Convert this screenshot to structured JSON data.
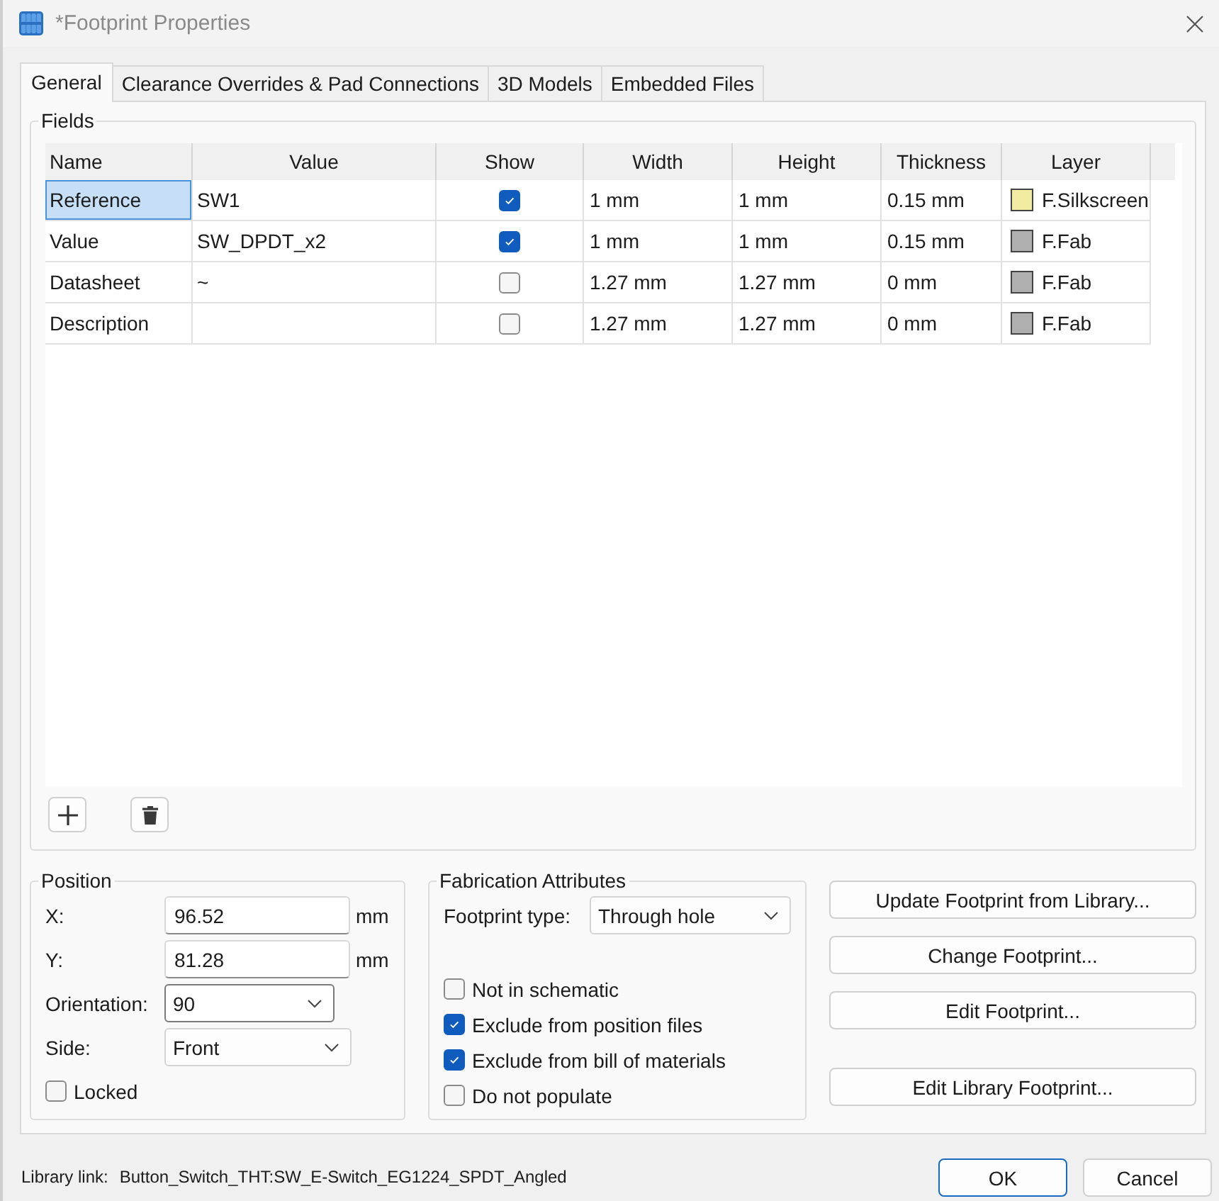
{
  "window": {
    "title": "*Footprint Properties"
  },
  "tabs": [
    {
      "label": "General",
      "selected": true
    },
    {
      "label": "Clearance Overrides & Pad Connections",
      "selected": false
    },
    {
      "label": "3D Models",
      "selected": false
    },
    {
      "label": "Embedded Files",
      "selected": false
    }
  ],
  "fields": {
    "title": "Fields",
    "columns": [
      "Name",
      "Value",
      "Show",
      "Width",
      "Height",
      "Thickness",
      "Layer"
    ],
    "rows": [
      {
        "name": "Reference",
        "value": "SW1",
        "show": true,
        "width": "1 mm",
        "height": "1 mm",
        "thickness": "0.15 mm",
        "layer": "F.Silkscreen",
        "color": "#f2eca2",
        "selected": true
      },
      {
        "name": "Value",
        "value": "SW_DPDT_x2",
        "show": true,
        "width": "1 mm",
        "height": "1 mm",
        "thickness": "0.15 mm",
        "layer": "F.Fab",
        "color": "#afafaf",
        "selected": false
      },
      {
        "name": "Datasheet",
        "value": "~",
        "show": false,
        "width": "1.27 mm",
        "height": "1.27 mm",
        "thickness": "0 mm",
        "layer": "F.Fab",
        "color": "#afafaf",
        "selected": false
      },
      {
        "name": "Description",
        "show": false,
        "width": "1.27 mm",
        "height": "1.27 mm",
        "thickness": "0 mm",
        "layer": "F.Fab",
        "color": "#afafaf",
        "selected": false
      }
    ]
  },
  "position": {
    "title": "Position",
    "fields": [
      {
        "kind": "input",
        "label": "X:",
        "value": "96.52",
        "unit": "mm"
      },
      {
        "kind": "input",
        "label": "Y:",
        "value": "81.28",
        "unit": "mm"
      },
      {
        "kind": "combo",
        "label": "Orientation:",
        "value": "90"
      },
      {
        "kind": "select",
        "label": "Side:",
        "value": "Front"
      }
    ],
    "locked": {
      "label": "Locked",
      "checked": false
    }
  },
  "fabrication": {
    "title": "Fabrication Attributes",
    "footprint_type": {
      "label": "Footprint type:",
      "value": "Through hole"
    },
    "options": [
      {
        "label": "Not in schematic",
        "checked": false
      },
      {
        "label": "Exclude from position files",
        "checked": true
      },
      {
        "label": "Exclude from bill of materials",
        "checked": true
      },
      {
        "label": "Do not populate",
        "checked": false
      }
    ]
  },
  "actions": [
    "Update Footprint from Library...",
    "Change Footprint...",
    "Edit Footprint...",
    "Edit Library Footprint..."
  ],
  "footer": {
    "library_link": {
      "label": "Library link:",
      "value": "Button_Switch_THT:SW_E-Switch_EG1224_SPDT_Angled"
    },
    "buttons": [
      {
        "label": "OK",
        "default": true
      },
      {
        "label": "Cancel",
        "default": false
      }
    ]
  }
}
